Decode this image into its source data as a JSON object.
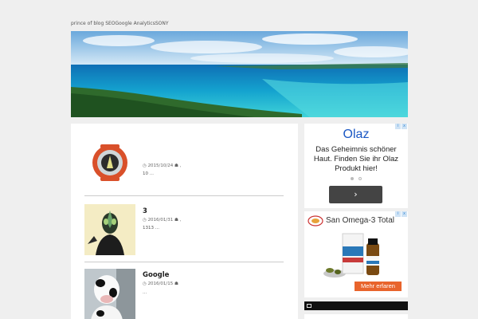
{
  "header": {
    "tagline": "prince of blog SEOGoogle AnalyticsSONY"
  },
  "posts": [
    {
      "title": "",
      "date": "2015/10/24",
      "tag_suffix": ",",
      "excerpt": "10 ...",
      "thumb_icon": "ghost-eyecon-icon"
    },
    {
      "title": "3",
      "date": "2016/01/31",
      "tag_suffix": ",",
      "excerpt": "1313 ...",
      "thumb_icon": "kamen-rider-figure-icon"
    },
    {
      "title": "Google",
      "date": "2016/01/15",
      "tag_suffix": "",
      "excerpt": "...",
      "thumb_icon": "cow-costume-icon"
    }
  ],
  "sidebar": {
    "ad1": {
      "title": "Olaz",
      "body": "Das Geheimnis schöner Haut. Finden Sie ihr Olaz Produkt hier!",
      "next_button": "›",
      "dots_active_index": 0,
      "accent": "#1a57c4"
    },
    "ad2": {
      "title": "San Omega-3 Total",
      "cta": "Mehr erfaren",
      "cta_color": "#e8642c"
    },
    "ad_close_icons": [
      "i",
      "x"
    ]
  }
}
